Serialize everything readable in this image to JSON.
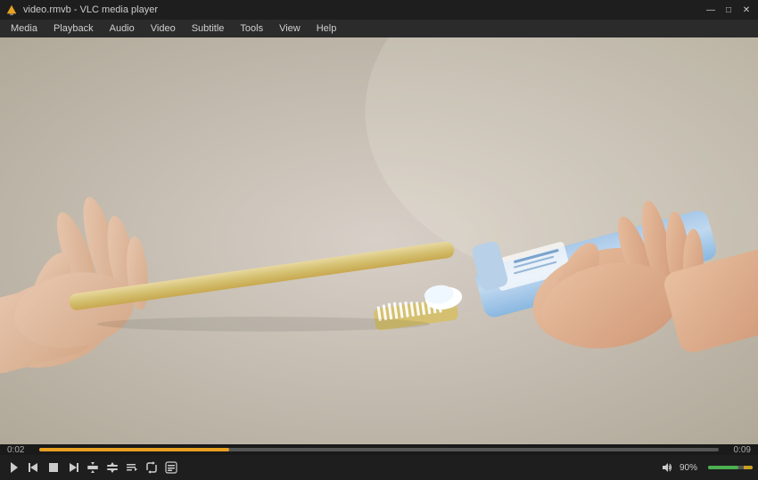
{
  "titleBar": {
    "title": "video.rmvb - VLC media player",
    "appIcon": "vlc-cone"
  },
  "windowControls": {
    "minimize": "—",
    "maximize": "□",
    "close": "✕"
  },
  "menuBar": {
    "items": [
      "Media",
      "Playback",
      "Audio",
      "Video",
      "Subtitle",
      "Tools",
      "View",
      "Help"
    ]
  },
  "progressBar": {
    "timeStart": "0:02",
    "timeEnd": "0:09",
    "fillPercent": 28
  },
  "controls": {
    "playPause": "play",
    "skipBack": "skip-back",
    "stop": "stop",
    "skipForward": "skip-forward",
    "expand": "expand",
    "shrink": "shrink",
    "playlist": "playlist",
    "loop": "loop",
    "shuffle": "shuffle",
    "extended": "extended"
  },
  "volume": {
    "label": "90%",
    "percent": 90
  }
}
